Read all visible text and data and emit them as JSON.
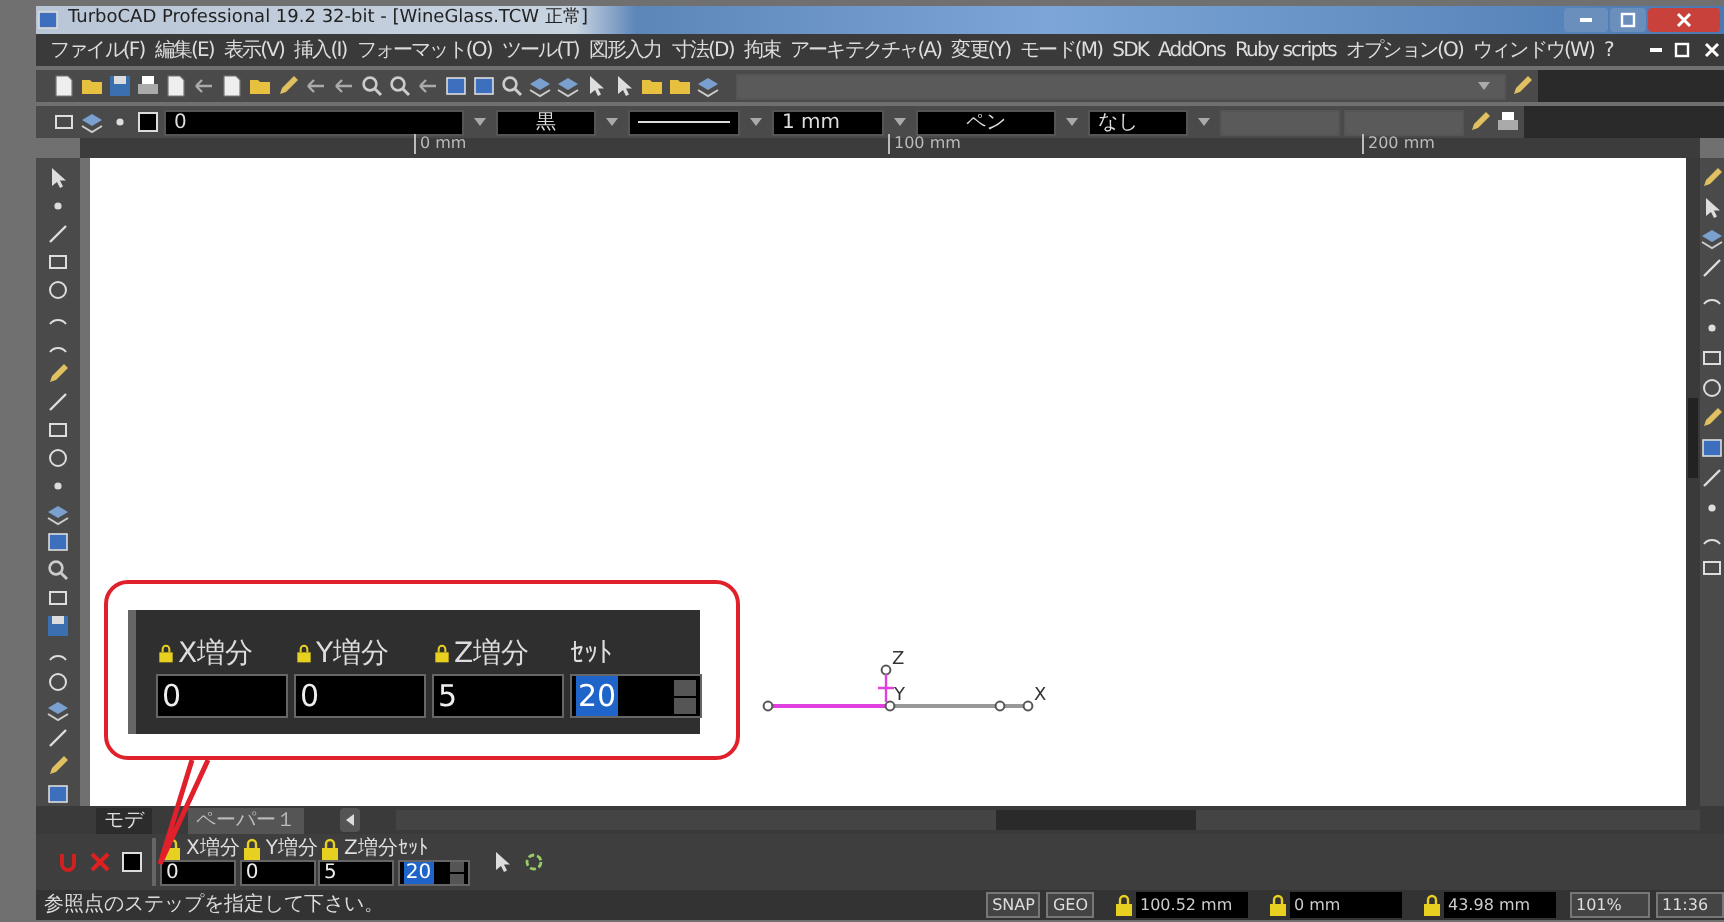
{
  "window": {
    "title": "TurboCAD Professional 19.2 32-bit - [WineGlass.TCW 正常]"
  },
  "menu": [
    "ファイル(F)",
    "編集(E)",
    "表示(V)",
    "挿入(I)",
    "フォーマット(O)",
    "ツール(T)",
    "図形入力",
    "寸法(D)",
    "拘束",
    "アーキテクチャ(A)",
    "変更(Y)",
    "モード(M)",
    "SDK",
    "AddOns",
    "Ruby scripts",
    "オプション(O)",
    "ウィンドウ(W)",
    "?"
  ],
  "properties_bar": {
    "layer": "0",
    "color_label": "黒",
    "line_width": "1 mm",
    "pen": "ペン",
    "fill": "なし"
  },
  "ruler": [
    "0 mm",
    "100 mm",
    "200 mm"
  ],
  "axis_labels": [
    "Z",
    "Y",
    "X"
  ],
  "callout": {
    "fields": [
      {
        "label": "X増分",
        "value": "0",
        "kind": "number",
        "selected": false
      },
      {
        "label": "Y増分",
        "value": "0",
        "kind": "number",
        "selected": false
      },
      {
        "label": "Z増分",
        "value": "5",
        "kind": "number",
        "selected": false
      },
      {
        "label": "ｾｯﾄ",
        "value": "20",
        "kind": "spinner",
        "selected": true
      }
    ]
  },
  "tabs": [
    {
      "label": "モデ",
      "selected": true
    },
    {
      "label": "ペーパー１",
      "selected": false
    }
  ],
  "input_bar": {
    "fields": [
      {
        "label": "X増分",
        "value": "0",
        "kind": "number",
        "selected": false
      },
      {
        "label": "Y増分",
        "value": "0",
        "kind": "number",
        "selected": false
      },
      {
        "label": "Z増分",
        "value": "5",
        "kind": "number",
        "selected": false
      },
      {
        "label": "ｾｯﾄ",
        "value": "20",
        "kind": "spinner",
        "selected": true
      }
    ]
  },
  "status_bar": {
    "message": "参照点のステップを指定して下さい。",
    "snap": "SNAP",
    "geo": "GEO",
    "x": "100.52 mm",
    "y": "0 mm",
    "z": "43.98 mm",
    "zoom": "101%",
    "time": "11:36"
  }
}
